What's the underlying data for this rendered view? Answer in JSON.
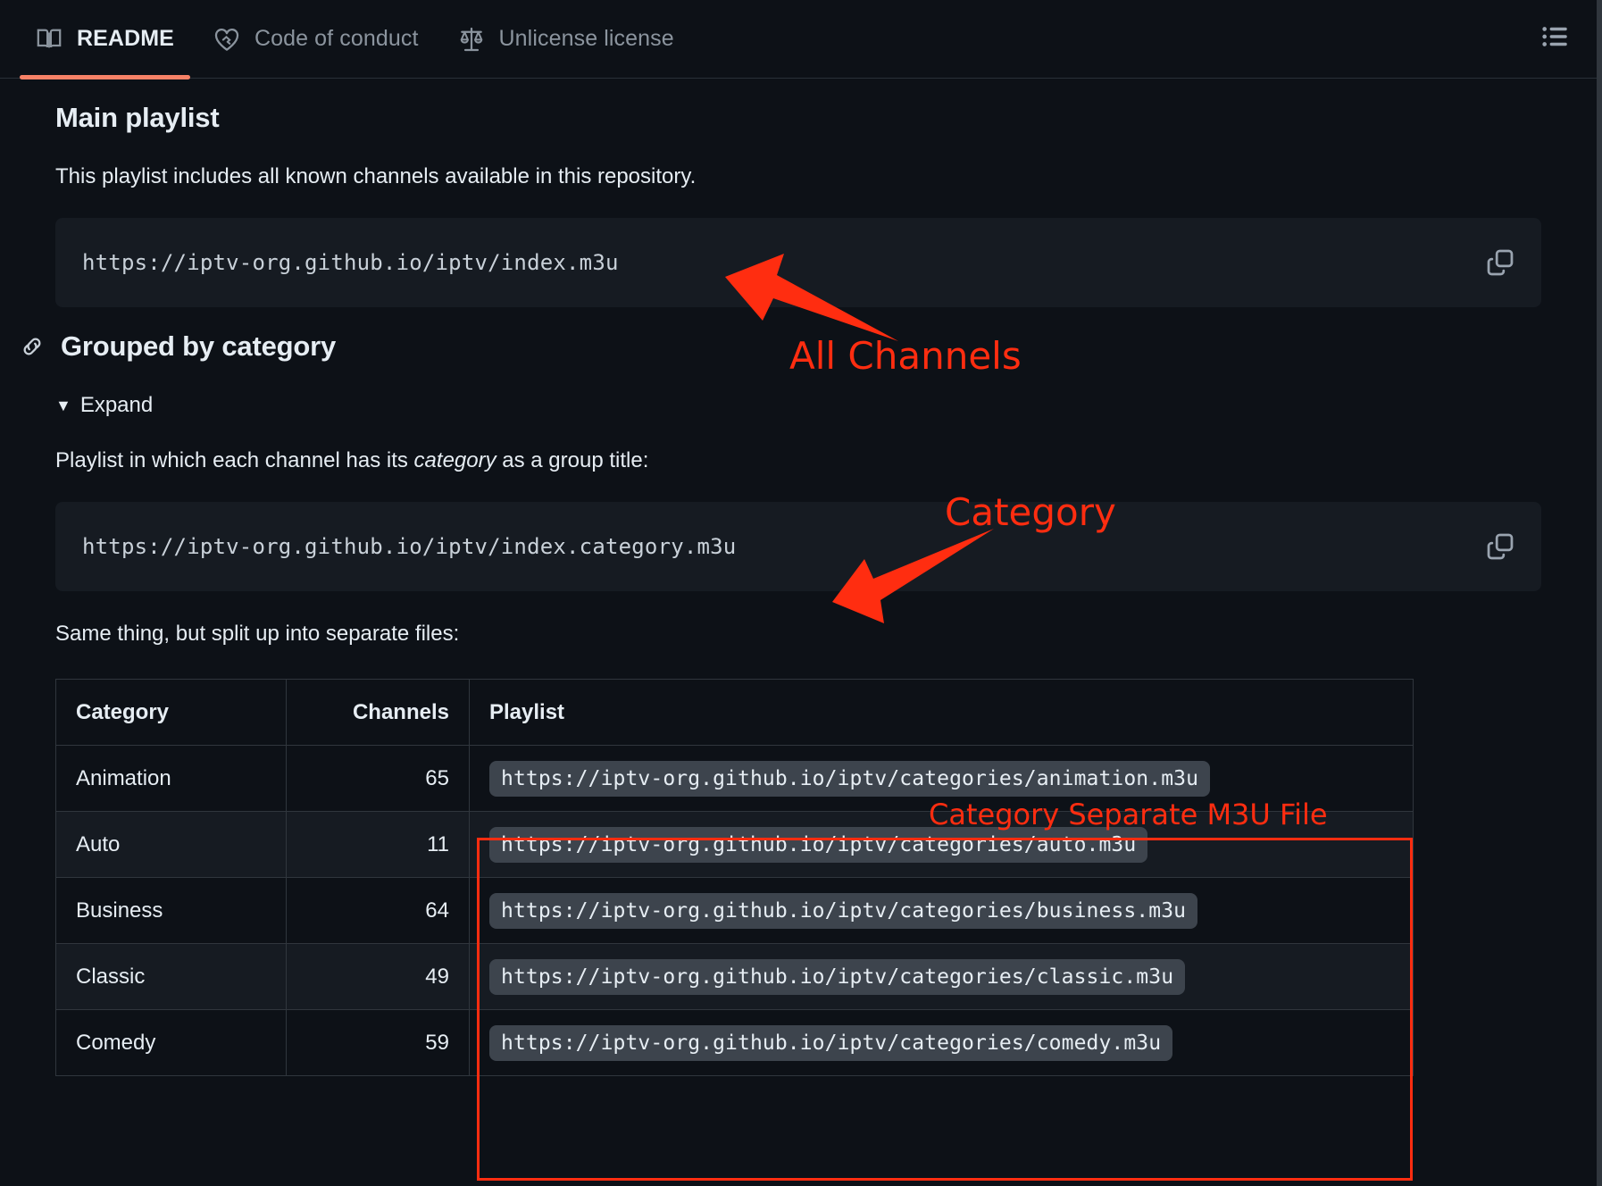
{
  "header": {
    "tabs": [
      {
        "label": "README",
        "icon": "book-icon",
        "active": true
      },
      {
        "label": "Code of conduct",
        "icon": "heart-handshake-icon",
        "active": false
      },
      {
        "label": "Unlicense license",
        "icon": "scale-icon",
        "active": false
      }
    ],
    "outline_icon": "list-unordered-icon"
  },
  "main": {
    "sections": [
      {
        "title": "Main playlist",
        "paragraph": "This playlist includes all known channels available in this repository.",
        "code": "https://iptv-org.github.io/iptv/index.m3u",
        "copy_icon": "copy-icon"
      },
      {
        "title": "Grouped by category",
        "anchor_icon": "link-icon",
        "expand_label": "Expand",
        "expand_caret": "▼",
        "paragraph_pre": "Playlist in which each channel has its ",
        "paragraph_em": "category",
        "paragraph_post": " as a group title:",
        "code": "https://iptv-org.github.io/iptv/index.category.m3u",
        "copy_icon": "copy-icon",
        "split_note": "Same thing, but split up into separate files:"
      }
    ],
    "table": {
      "columns": [
        "Category",
        "Channels",
        "Playlist"
      ],
      "rows": [
        {
          "category": "Animation",
          "channels": "65",
          "playlist": "https://iptv-org.github.io/iptv/categories/animation.m3u"
        },
        {
          "category": "Auto",
          "channels": "11",
          "playlist": "https://iptv-org.github.io/iptv/categories/auto.m3u"
        },
        {
          "category": "Business",
          "channels": "64",
          "playlist": "https://iptv-org.github.io/iptv/categories/business.m3u"
        },
        {
          "category": "Classic",
          "channels": "49",
          "playlist": "https://iptv-org.github.io/iptv/categories/classic.m3u"
        },
        {
          "category": "Comedy",
          "channels": "59",
          "playlist": "https://iptv-org.github.io/iptv/categories/comedy.m3u"
        }
      ]
    }
  },
  "annotations": {
    "color": "#ff2d10",
    "all_channels": "All Channels",
    "category": "Category",
    "separate_file": "Category Separate M3U File"
  },
  "colors": {
    "background": "#0d1117",
    "surface": "#161b22",
    "border": "#30363d",
    "text": "#e6edf3",
    "muted": "#8b949e",
    "active_tab_underline": "#f78166",
    "code_pill": "#3d444d"
  }
}
